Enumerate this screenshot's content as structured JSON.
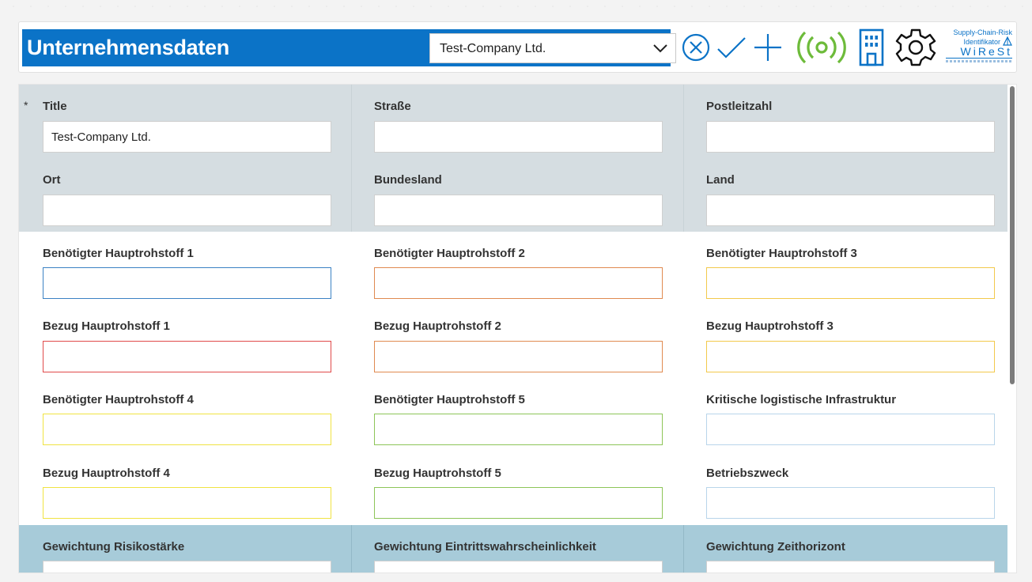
{
  "header": {
    "title": "Unternehmensdaten",
    "company_select": {
      "value": "Test-Company Ltd."
    },
    "logo": {
      "line1": "Supply-Chain-Risk",
      "line2": "Identifikator",
      "brand": "WiReSt"
    },
    "icons": [
      "cancel-circle-icon",
      "checkmark-icon",
      "plus-icon",
      "broadcast-icon",
      "building-icon",
      "gear-icon"
    ]
  },
  "colors": {
    "header_blue": "#0b73c7",
    "band_grey": "#d5dde1",
    "band_blue": "#a7cbd9",
    "broadcast_green": "#6dbb3a"
  },
  "form": {
    "address": {
      "title": {
        "label": "Title",
        "value": "Test-Company Ltd.",
        "required_mark": "*"
      },
      "strasse": {
        "label": "Straße",
        "value": ""
      },
      "plz": {
        "label": "Postleitzahl",
        "value": ""
      },
      "ort": {
        "label": "Ort",
        "value": ""
      },
      "bundesland": {
        "label": "Bundesland",
        "value": ""
      },
      "land": {
        "label": "Land",
        "value": ""
      }
    },
    "raw": {
      "h1": {
        "label": "Benötigter Hauptrohstoff 1",
        "value": "",
        "border": "#3b82c4"
      },
      "h2": {
        "label": "Benötigter Hauptrohstoff 2",
        "value": "",
        "border": "#e08a50"
      },
      "h3": {
        "label": "Benötigter Hauptrohstoff 3",
        "value": "",
        "border": "#f2c94c"
      },
      "b1": {
        "label": "Bezug Hauptrohstoff 1",
        "value": "",
        "border": "#e04a4a"
      },
      "b2": {
        "label": "Bezug Hauptrohstoff 2",
        "value": "",
        "border": "#e08a50"
      },
      "b3": {
        "label": "Bezug Hauptrohstoff 3",
        "value": "",
        "border": "#f2c94c"
      },
      "h4": {
        "label": "Benötigter Hauptrohstoff 4",
        "value": "",
        "border": "#f0e342"
      },
      "h5": {
        "label": "Benötigter Hauptrohstoff 5",
        "value": "",
        "border": "#8dc558"
      },
      "kli": {
        "label": "Kritische logistische Infrastruktur",
        "value": "",
        "border": "#b9d5ea"
      },
      "b4": {
        "label": "Bezug Hauptrohstoff 4",
        "value": "",
        "border": "#f0e342"
      },
      "b5": {
        "label": "Bezug Hauptrohstoff 5",
        "value": "",
        "border": "#8dc558"
      },
      "zweck": {
        "label": "Betriebszweck",
        "value": "",
        "border": "#b9d5ea"
      }
    },
    "weights": {
      "risiko": {
        "label": "Gewichtung Risikostärke"
      },
      "eintritt": {
        "label": "Gewichtung Eintrittswahrscheinlichkeit"
      },
      "zeit": {
        "label": "Gewichtung Zeithorizont"
      }
    }
  }
}
